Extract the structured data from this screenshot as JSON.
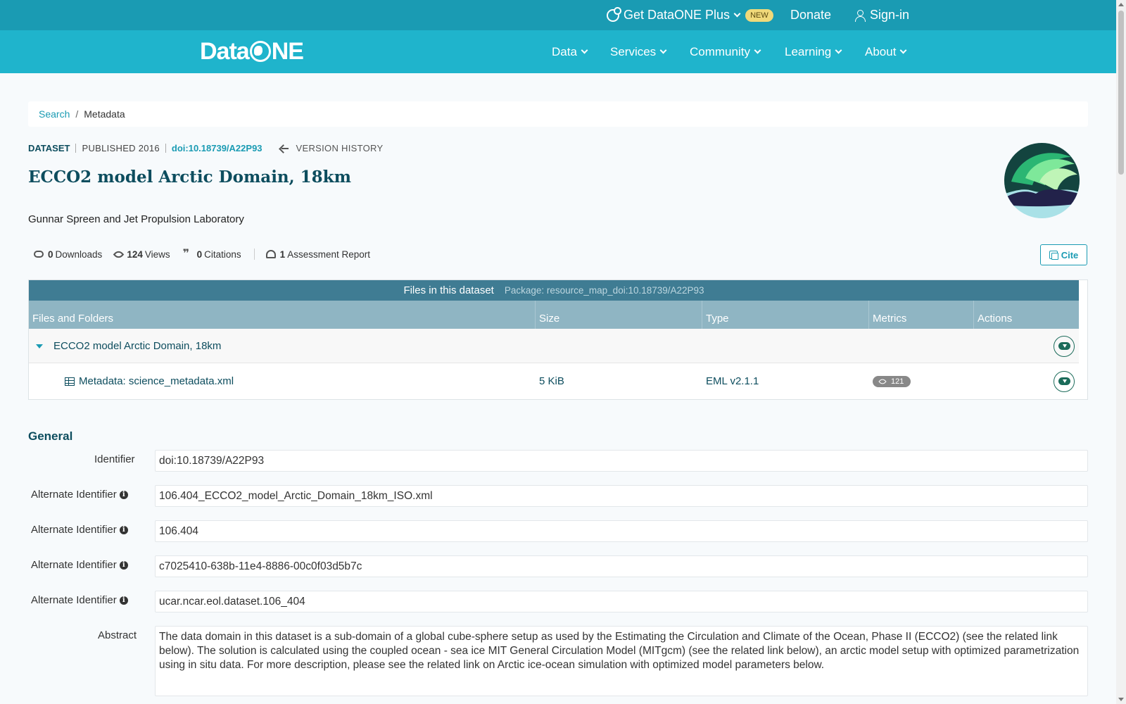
{
  "topbar": {
    "plus_label": "Get DataONE Plus",
    "new_badge": "NEW",
    "donate": "Donate",
    "signin": "Sign-in"
  },
  "nav": {
    "logo_left": "Data",
    "logo_right": "NE",
    "items": [
      "Data",
      "Services",
      "Community",
      "Learning",
      "About"
    ]
  },
  "breadcrumb": {
    "search": "Search",
    "sep": "/",
    "current": "Metadata"
  },
  "dataset": {
    "type": "DATASET",
    "published": "PUBLISHED 2016",
    "doi": "doi:10.18739/A22P93",
    "version_history": "VERSION HISTORY",
    "title": "ECCO2 model Arctic Domain, 18km",
    "authors": "Gunnar Spreen and Jet Propulsion Laboratory"
  },
  "stats": {
    "downloads_count": "0",
    "downloads_label": "Downloads",
    "views_count": "124",
    "views_label": "Views",
    "citations_count": "0",
    "citations_label": "Citations",
    "assessment_count": "1",
    "assessment_label": "Assessment Report"
  },
  "cite_label": "Cite",
  "files": {
    "heading": "Files in this dataset",
    "package": "Package: resource_map_doi:10.18739/A22P93",
    "columns": [
      "Files and Folders",
      "Size",
      "Type",
      "Metrics",
      "Actions"
    ],
    "folder": "ECCO2 model Arctic Domain, 18km",
    "file": {
      "name": "Metadata: science_metadata.xml",
      "size": "5 KiB",
      "type": "EML v2.1.1",
      "views": "121"
    }
  },
  "general": {
    "title": "General",
    "fields": [
      {
        "label": "Identifier",
        "value": "doi:10.18739/A22P93"
      },
      {
        "label": "Alternate Identifier",
        "value": "106.404_ECCO2_model_Arctic_Domain_18km_ISO.xml"
      },
      {
        "label": "Alternate Identifier",
        "value": "106.404"
      },
      {
        "label": "Alternate Identifier",
        "value": "c7025410-638b-11e4-8886-00c0f03d5b7c"
      },
      {
        "label": "Alternate Identifier",
        "value": "ucar.ncar.eol.dataset.106_404"
      }
    ],
    "abstract_label": "Abstract",
    "abstract": "The data domain in this dataset is a sub-domain of a global cube-sphere setup as used by the Estimating the Circulation and Climate of the Ocean, Phase II (ECCO2) (see the related link below). The solution is calculated using the coupled ocean - sea ice MIT General Circulation Model (MITgcm) (see the related link below), an arctic model setup with optimized parametrization using in situ data. For more description, please see the related link on Arctic ice-ocean simulation with optimized model parameters below."
  },
  "colors": {
    "topbar": "#1a9bb3",
    "navbar": "#1fb4cc",
    "files_header": "#3f7c93",
    "title": "#0d4d5e"
  }
}
